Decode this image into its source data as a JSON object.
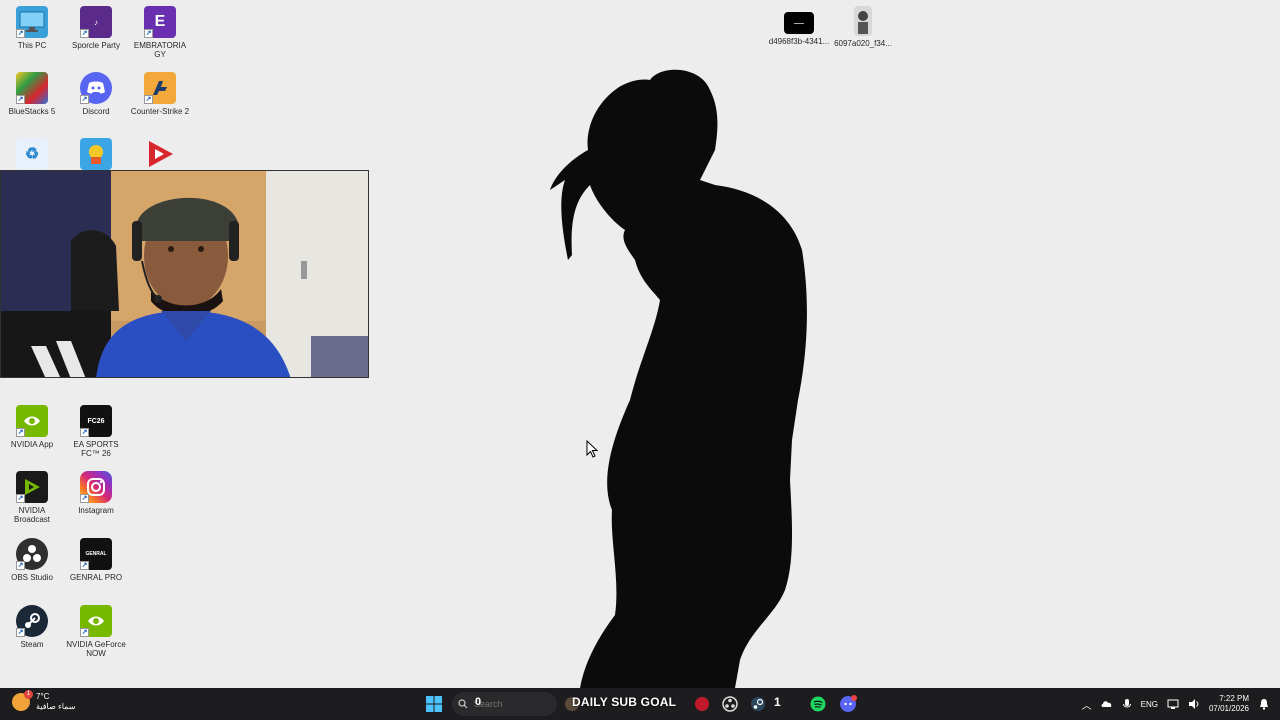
{
  "desktop": {
    "icons": [
      {
        "label": "This PC",
        "color": "#39a0d8",
        "icon": "monitor-icon"
      },
      {
        "label": "Sporcle Party",
        "color": "#5b2b8c",
        "icon": "party-icon"
      },
      {
        "label": "EMBRATORIA GY",
        "color": "#6a2fb0",
        "icon": "letter-e-icon"
      },
      {
        "label": "BlueStacks 5",
        "color": "#2f9e44",
        "icon": "bluestacks-icon"
      },
      {
        "label": "Discord",
        "color": "#5865f2",
        "icon": "discord-icon"
      },
      {
        "label": "Counter-Strike 2",
        "color": "#1e5ba8",
        "icon": "cs2-icon"
      },
      {
        "label": "",
        "color": "#e8f1fb",
        "icon": "recycle-bin-icon"
      },
      {
        "label": "",
        "color": "#3aa6e6",
        "icon": "stumble-guys-icon"
      },
      {
        "label": "",
        "color": "#d8262d",
        "icon": "play-arrow-icon"
      },
      {
        "label": "NVIDIA App",
        "color": "#76b900",
        "icon": "nvidia-icon"
      },
      {
        "label": "EA SPORTS FC™ 26",
        "color": "#111111",
        "icon": "ea-fc-icon"
      },
      {
        "label": "NVIDIA Broadcast",
        "color": "#1a1a1a",
        "icon": "nvidia-broadcast-icon"
      },
      {
        "label": "Instagram",
        "color": "#d62976",
        "icon": "instagram-icon"
      },
      {
        "label": "OBS Studio",
        "color": "#302e31",
        "icon": "obs-icon"
      },
      {
        "label": "GENRAL PRO",
        "color": "#111111",
        "icon": "genral-pro-icon"
      },
      {
        "label": "Steam",
        "color": "#1b2838",
        "icon": "steam-icon"
      },
      {
        "label": "NVIDIA GeForce NOW",
        "color": "#76b900",
        "icon": "geforce-now-icon"
      }
    ],
    "top_files": [
      {
        "label": "d4968f3b-4341...",
        "icon": "image-file-icon"
      },
      {
        "label": "6097a020_f34...",
        "icon": "image-file-icon"
      }
    ]
  },
  "taskbar": {
    "weather_temp": "7°C",
    "weather_desc": "سماء صافية",
    "weather_badge": "1",
    "search_placeholder": "Search",
    "search_count": "0",
    "overlay_title": "DAILY SUB GOAL",
    "overlay_count": "1",
    "language": "ENG",
    "time": "7:22 PM",
    "date": "07/01/2026"
  },
  "colors": {
    "taskbar_bg": "#1d1d1f",
    "desktop_bg": "#ededed",
    "accent": "#0a84ff"
  }
}
